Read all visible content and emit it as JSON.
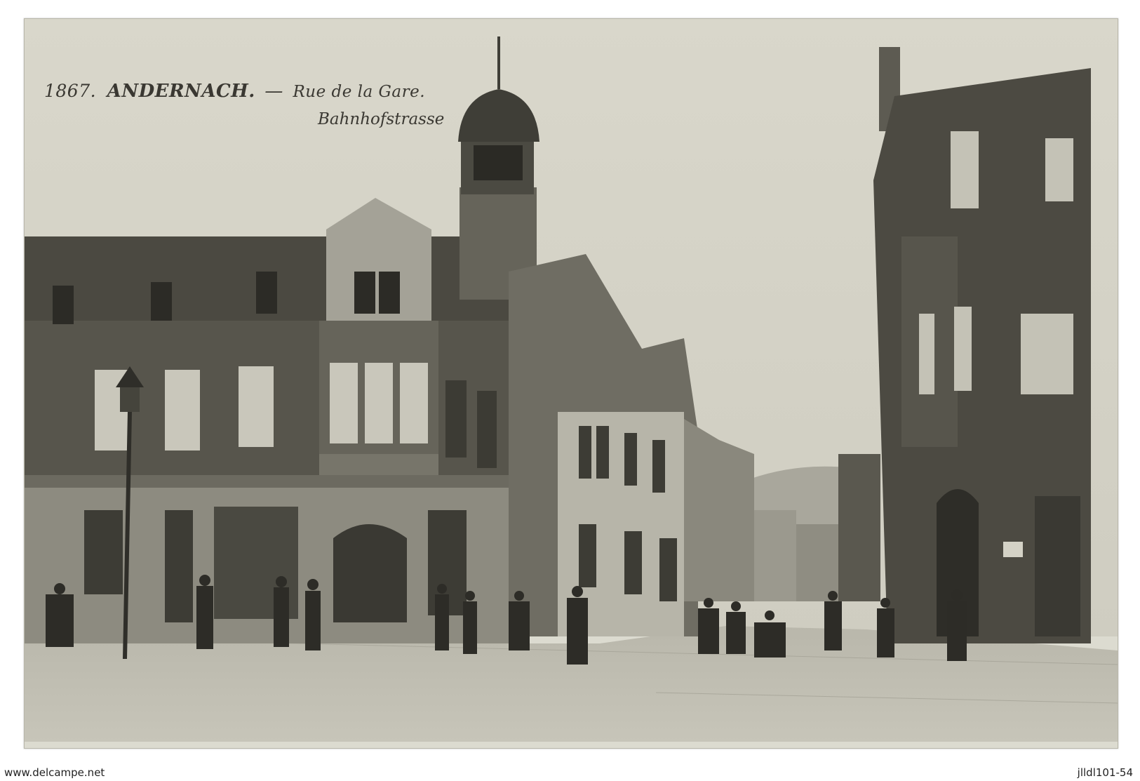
{
  "postcard": {
    "number": "1867.",
    "town": "ANDERNACH.",
    "dash": "—",
    "street_fr": "Rue de la Gare.",
    "street_de": "Bahnhofstrasse"
  },
  "footer": {
    "left_text": "www.delcampe.net",
    "right_text": "jlldl101-54"
  },
  "colors": {
    "paper": "#dcdbd0",
    "sky": "#d6d4c8",
    "building_dark": "#4a4840",
    "building_mid": "#6b6960",
    "street": "#b8b6aa"
  }
}
